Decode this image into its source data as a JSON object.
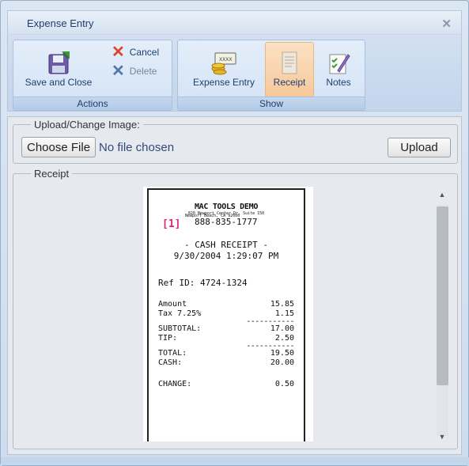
{
  "window": {
    "title": "Expense Entry",
    "close_icon": "close-icon"
  },
  "ribbon": {
    "actions": {
      "label": "Actions",
      "save_close": "Save and Close",
      "cancel": "Cancel",
      "delete": "Delete"
    },
    "show": {
      "label": "Show",
      "expense_entry": "Expense Entry",
      "receipt": "Receipt",
      "notes": "Notes",
      "selected": "Receipt"
    }
  },
  "upload": {
    "legend": "Upload/Change Image:",
    "choose_file": "Choose File",
    "file_status": "No file chosen",
    "upload_button": "Upload"
  },
  "receipt": {
    "legend": "Receipt",
    "image": {
      "company": "MAC TOOLS DEMO",
      "address1": "820 Newport Center Dr. Suite 150",
      "address2": "Newport Beach, CA 92660",
      "tag": "[1]",
      "phone": "888-835-1777",
      "heading": "- CASH RECEIPT -",
      "datetime": "9/30/2004  1:29:07 PM",
      "ref": "Ref ID:  4724-1324",
      "amount_label": "Amount",
      "amount": "15.85",
      "tax_label": "Tax 7.25%",
      "tax": "1.15",
      "dash1": "-----------",
      "subtotal_label": "SUBTOTAL:",
      "subtotal": "17.00",
      "tip_label": "TIP:",
      "tip": "2.50",
      "dash2": "-----------",
      "total_label": "TOTAL:",
      "total": "19.50",
      "cash_label": "CASH:",
      "cash": "20.00",
      "change_label": "CHANGE:",
      "change": "0.50"
    }
  },
  "colors": {
    "accent": "#1f3f6e",
    "selected_bg": "#f7c89a",
    "cancel_x": "#e0432c",
    "tag": "#e0267c"
  }
}
